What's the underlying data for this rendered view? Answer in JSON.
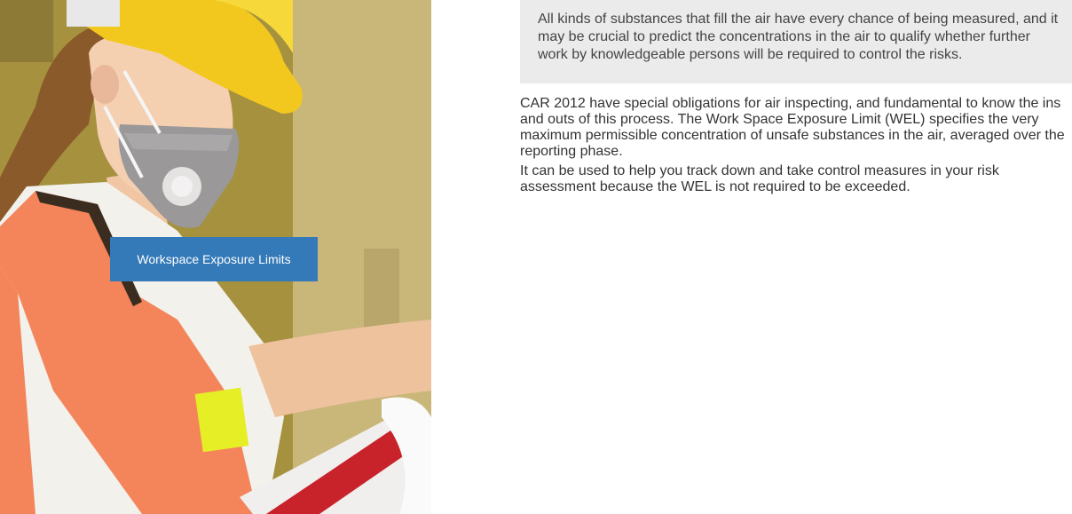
{
  "hero": {
    "button_label": "Workspace Exposure Limits"
  },
  "callout": {
    "text": "All kinds of substances that fill the air have every chance of being measured, and it may be crucial to predict the concentrations in the air to qualify whether further work by knowledgeable persons will be required to control the risks."
  },
  "content": {
    "paragraph_1": "CAR 2012 have special obligations for air inspecting, and fundamental to know the ins and outs of this process. The Work Space Exposure Limit (WEL) specifies the very maximum permissible concentration of unsafe substances in the air, averaged over the reporting phase.",
    "paragraph_2": "It can be used to help you track down and take control measures in your risk assessment because the WEL is not required to be exceeded."
  },
  "colors": {
    "button_bg": "#3479b8",
    "callout_bg": "#ebebeb",
    "hard_hat": "#f2c81e",
    "safety_vest": "#f4845a"
  }
}
